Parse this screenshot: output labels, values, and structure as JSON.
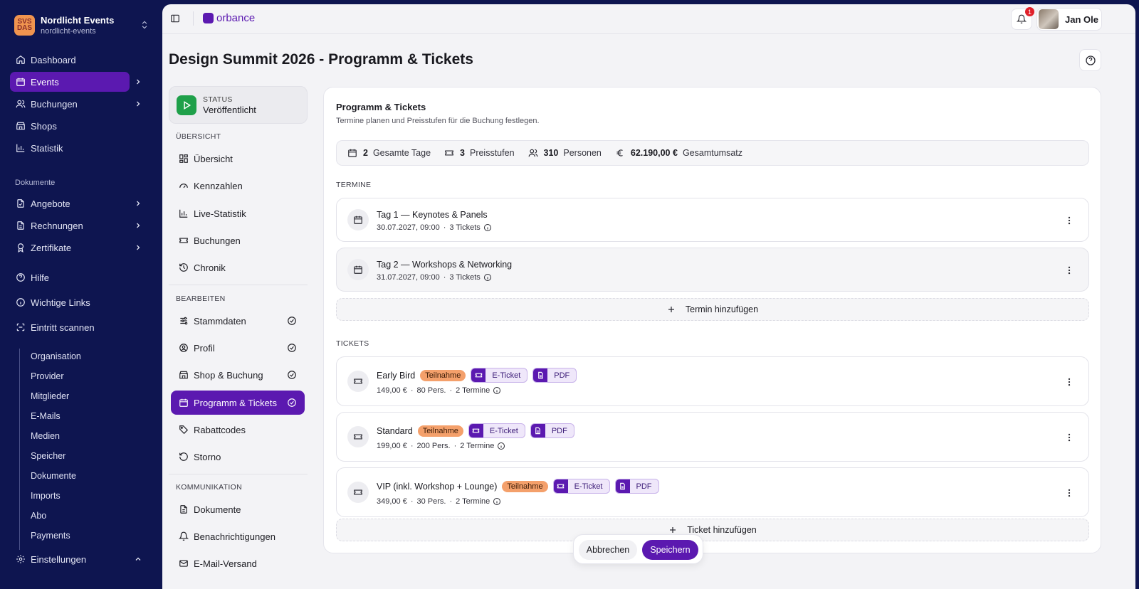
{
  "org": {
    "logo": "SVS DAS",
    "name": "Nordlicht Events",
    "slug": "nordlicht-events"
  },
  "nav": {
    "items": [
      {
        "label": "Dashboard",
        "icon": "home-icon"
      },
      {
        "label": "Events",
        "icon": "calendar-icon",
        "active": true
      },
      {
        "label": "Buchungen",
        "icon": "users-icon"
      },
      {
        "label": "Shops",
        "icon": "store-icon"
      },
      {
        "label": "Statistik",
        "icon": "chart-icon"
      }
    ],
    "docs_section": "Dokumente",
    "docs": [
      {
        "label": "Angebote",
        "icon": "file-check-icon"
      },
      {
        "label": "Rechnungen",
        "icon": "file-text-icon"
      },
      {
        "label": "Zertifikate",
        "icon": "award-icon"
      }
    ],
    "misc": [
      {
        "label": "Hilfe",
        "icon": "help-circle-icon"
      },
      {
        "label": "Wichtige Links",
        "icon": "info-icon"
      },
      {
        "label": "Eintritt scannen",
        "icon": "scan-icon"
      }
    ],
    "settings_sub": [
      "Organisation",
      "Provider",
      "Mitglieder",
      "E-Mails",
      "Medien",
      "Speicher",
      "Dokumente",
      "Imports",
      "Abo",
      "Payments"
    ],
    "settings": "Einstellungen"
  },
  "topbar": {
    "brand": "orbance",
    "notifications": "1",
    "user": "Jan Ole"
  },
  "page": {
    "title": "Design Summit 2026 - Programm & Tickets"
  },
  "status": {
    "label": "STATUS",
    "value": "Veröffentlicht"
  },
  "subnav": {
    "overview_title": "ÜBERSICHT",
    "overview": [
      "Übersicht",
      "Kennzahlen",
      "Live-Statistik",
      "Buchungen",
      "Chronik"
    ],
    "edit_title": "BEARBEITEN",
    "edit": [
      "Stammdaten",
      "Profil",
      "Shop & Buchung",
      "Programm & Tickets",
      "Rabattcodes",
      "Storno"
    ],
    "comm_title": "KOMMUNIKATION",
    "comm": [
      "Dokumente",
      "Benachrichtigungen",
      "E-Mail-Versand"
    ]
  },
  "content": {
    "title": "Programm & Tickets",
    "subtitle": "Termine planen und Preisstufen für die Buchung festlegen.",
    "stats": [
      {
        "value": "2",
        "label": "Gesamte Tage"
      },
      {
        "value": "3",
        "label": "Preisstufen"
      },
      {
        "value": "310",
        "label": "Personen"
      },
      {
        "value": "62.190,00 €",
        "label": "Gesamtumsatz"
      }
    ],
    "dates_title": "TERMINE",
    "dates": [
      {
        "title": "Tag 1 — Keynotes & Panels",
        "datetime": "30.07.2027, 09:00",
        "tickets": "3 Tickets"
      },
      {
        "title": "Tag 2 — Workshops & Networking",
        "datetime": "31.07.2027, 09:00",
        "tickets": "3 Tickets"
      }
    ],
    "add_date": "Termin hinzufügen",
    "tickets_title": "TICKETS",
    "tickets": [
      {
        "name": "Early Bird",
        "tag": "Teilnahme",
        "eticket": "E-Ticket",
        "pdf": "PDF",
        "price": "149,00 €",
        "persons": "80 Pers.",
        "dates": "2 Termine"
      },
      {
        "name": "Standard",
        "tag": "Teilnahme",
        "eticket": "E-Ticket",
        "pdf": "PDF",
        "price": "199,00 €",
        "persons": "200 Pers.",
        "dates": "2 Termine"
      },
      {
        "name": "VIP (inkl. Workshop + Lounge)",
        "tag": "Teilnahme",
        "eticket": "E-Ticket",
        "pdf": "PDF",
        "price": "349,00 €",
        "persons": "30 Pers.",
        "dates": "2 Termine"
      }
    ],
    "add_ticket": "Ticket hinzufügen",
    "cancel": "Abbrechen",
    "save": "Speichern"
  },
  "colors": {
    "accent": "#5b19b0",
    "sidebar_bg": "#0e1550",
    "status_green": "#1fa04a",
    "tag_orange": "#f4a06b"
  }
}
